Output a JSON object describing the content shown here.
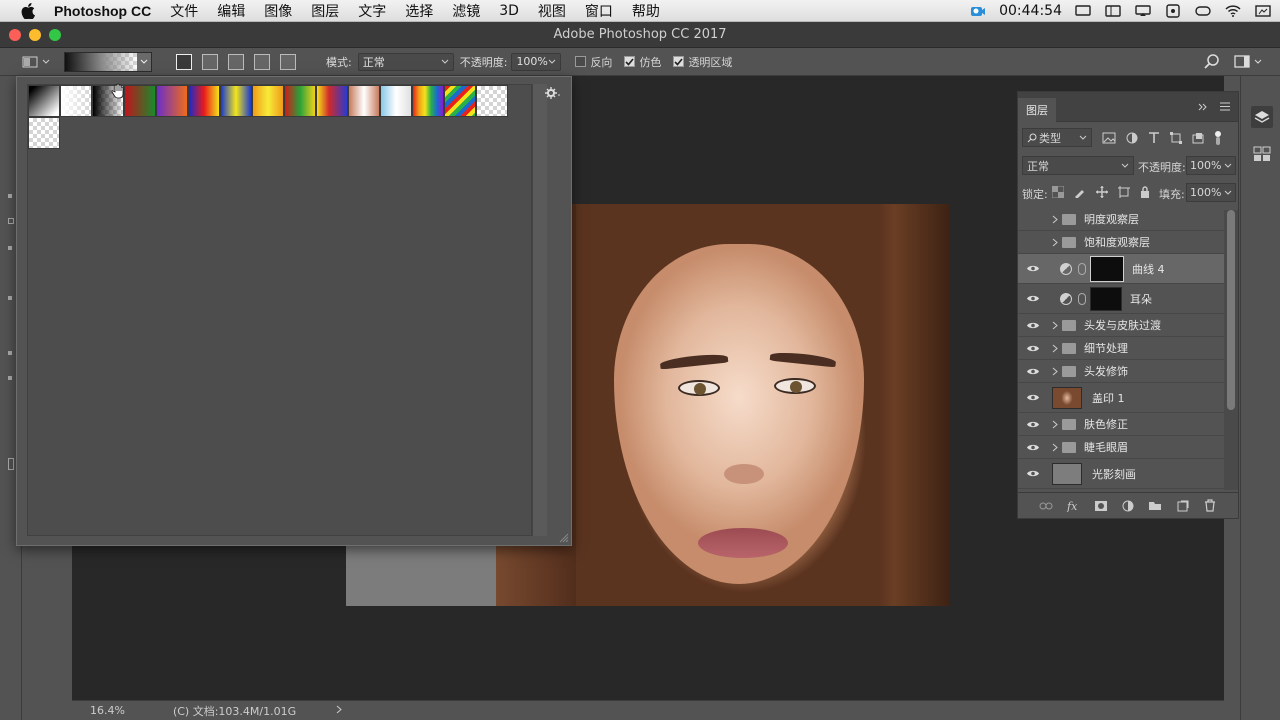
{
  "menubar": {
    "app_name": "Photoshop CC",
    "items": [
      "文件",
      "编辑",
      "图像",
      "图层",
      "文字",
      "选择",
      "滤镜",
      "3D",
      "视图",
      "窗口",
      "帮助"
    ],
    "clock": "00:44:54"
  },
  "window": {
    "title": "Adobe Photoshop CC 2017"
  },
  "options": {
    "mode_label": "模式:",
    "mode_value": "正常",
    "opacity_label": "不透明度:",
    "opacity_value": "100%",
    "reverse_label": "反向",
    "reverse_checked": false,
    "dither_label": "仿色",
    "dither_checked": true,
    "transparency_label": "透明区域",
    "transparency_checked": true
  },
  "layers_panel": {
    "tab_label": "图层",
    "filter_kind": "类型",
    "blend_mode": "正常",
    "opacity_label": "不透明度:",
    "opacity_value": "100%",
    "lock_label": "锁定:",
    "fill_label": "填充:",
    "fill_value": "100%",
    "layers": [
      {
        "name": "明度观察层",
        "kind": "group",
        "visible": false
      },
      {
        "name": "饱和度观察层",
        "kind": "group",
        "visible": false
      },
      {
        "name": "曲线 4",
        "kind": "adjustment",
        "visible": true,
        "selected": true
      },
      {
        "name": "耳朵",
        "kind": "adjustment",
        "visible": true
      },
      {
        "name": "头发与皮肤过渡",
        "kind": "group",
        "visible": true
      },
      {
        "name": "细节处理",
        "kind": "group",
        "visible": true
      },
      {
        "name": "头发修饰",
        "kind": "group",
        "visible": true
      },
      {
        "name": "盖印 1",
        "kind": "pixel",
        "visible": true
      },
      {
        "name": "肤色修正",
        "kind": "group",
        "visible": true
      },
      {
        "name": "睫毛眼眉",
        "kind": "group",
        "visible": true
      },
      {
        "name": "光影刻画",
        "kind": "pixel",
        "visible": true
      }
    ]
  },
  "statusbar": {
    "zoom": "16.4%",
    "doc_info": "(C) 文档:103.4M/1.01G"
  }
}
